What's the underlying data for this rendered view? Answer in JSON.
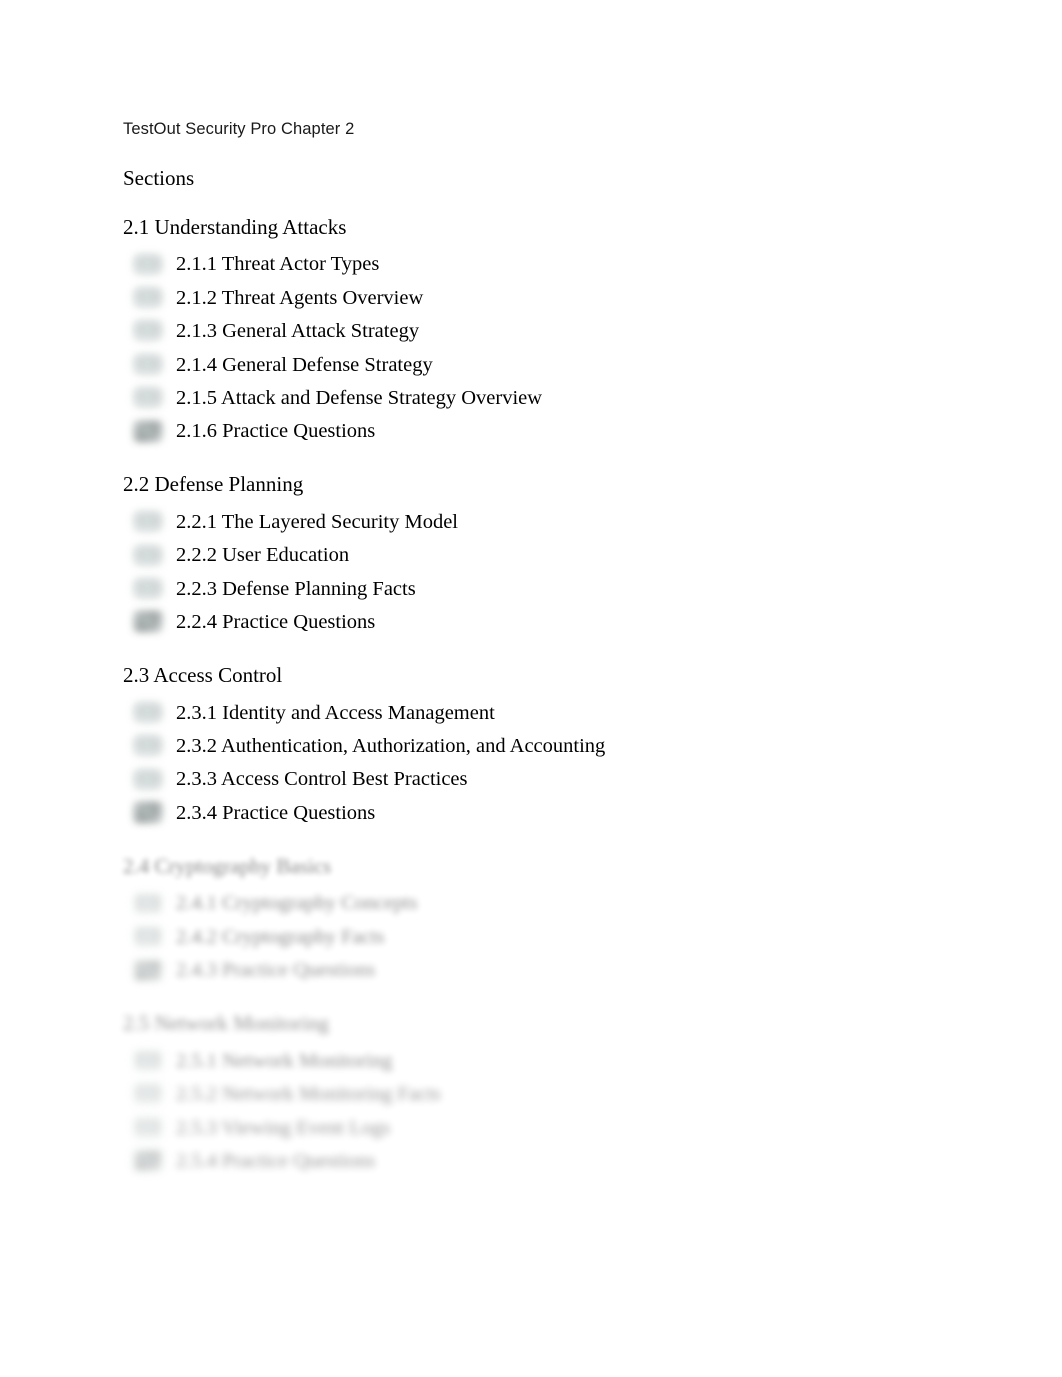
{
  "document": {
    "title": "TestOut Security Pro Chapter 2",
    "sections_label": "Sections"
  },
  "sections": [
    {
      "heading": "2.1 Understanding Attacks",
      "blur": "none",
      "items": [
        {
          "label": "2.1.1 Threat Actor Types",
          "icon": "video-icon"
        },
        {
          "label": "2.1.2 Threat Agents Overview",
          "icon": "video-icon"
        },
        {
          "label": "2.1.3 General Attack Strategy",
          "icon": "video-icon"
        },
        {
          "label": "2.1.4 General Defense Strategy",
          "icon": "video-icon"
        },
        {
          "label": "2.1.5 Attack and Defense Strategy Overview",
          "icon": "video-icon"
        },
        {
          "label": "2.1.6 Practice Questions",
          "icon": "checklist-icon"
        }
      ]
    },
    {
      "heading": "2.2 Defense Planning",
      "blur": "none",
      "items": [
        {
          "label": "2.2.1 The Layered Security Model",
          "icon": "video-icon"
        },
        {
          "label": "2.2.2 User Education",
          "icon": "video-icon"
        },
        {
          "label": "2.2.3 Defense Planning Facts",
          "icon": "document-icon"
        },
        {
          "label": "2.2.4 Practice Questions",
          "icon": "checklist-icon"
        }
      ]
    },
    {
      "heading": "2.3 Access Control",
      "blur": "none",
      "items": [
        {
          "label": "2.3.1 Identity and Access Management",
          "icon": "video-icon"
        },
        {
          "label": "2.3.2 Authentication, Authorization, and Accounting",
          "icon": "video-icon"
        },
        {
          "label": "2.3.3 Access Control Best Practices",
          "icon": "document-icon"
        },
        {
          "label": "2.3.4 Practice Questions",
          "icon": "checklist-icon"
        }
      ]
    },
    {
      "heading": "2.4 Cryptography Basics",
      "blur": "light",
      "items": [
        {
          "label": "2.4.1 Cryptography Concepts",
          "icon": "video-icon"
        },
        {
          "label": "2.4.2 Cryptography Facts",
          "icon": "document-icon"
        },
        {
          "label": "2.4.3 Practice Questions",
          "icon": "checklist-icon"
        }
      ]
    },
    {
      "heading": "2.5 Network Monitoring",
      "blur": "heavy",
      "items": [
        {
          "label": "2.5.1 Network Monitoring",
          "icon": "video-icon"
        },
        {
          "label": "2.5.2 Network Monitoring Facts",
          "icon": "document-icon"
        },
        {
          "label": "2.5.3 Viewing Event Logs",
          "icon": "video-icon"
        },
        {
          "label": "2.5.4 Practice Questions",
          "icon": "checklist-icon"
        }
      ]
    }
  ],
  "colors": {
    "page_background": "#ffffff",
    "text": "#000000",
    "title_text": "#1a1a1a",
    "marker_gray": "#9a9e9e"
  }
}
